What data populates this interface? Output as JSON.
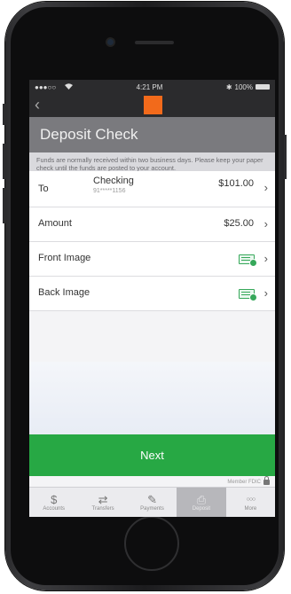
{
  "status_bar": {
    "signal": "●●●○○",
    "wifi": "wifi-icon",
    "time": "4:21 PM",
    "bluetooth": "bluetooth-icon",
    "battery_pct": "100%"
  },
  "nav": {
    "back": "‹"
  },
  "page_title": "Deposit Check",
  "info_text": "Funds are normally received within two business days. Please keep your paper check until the funds are posted to your account.",
  "rows": {
    "to": {
      "label": "To",
      "account_name": "Checking",
      "account_number": "91*****1156",
      "balance": "$101.00"
    },
    "amount": {
      "label": "Amount",
      "value": "$25.00"
    },
    "front_image": {
      "label": "Front Image"
    },
    "back_image": {
      "label": "Back Image"
    }
  },
  "next_label": "Next",
  "footer_note": "Member FDIC",
  "tabs": [
    {
      "icon": "$",
      "label": "Accounts"
    },
    {
      "icon": "⇄",
      "label": "Transfers"
    },
    {
      "icon": "✎",
      "label": "Payments"
    },
    {
      "icon": "⎙",
      "label": "Deposit"
    },
    {
      "icon": "○○○",
      "label": "More"
    }
  ],
  "colors": {
    "brand": "#f26a1b",
    "accent_green": "#27a844",
    "title_bar": "#7a7a7e"
  }
}
